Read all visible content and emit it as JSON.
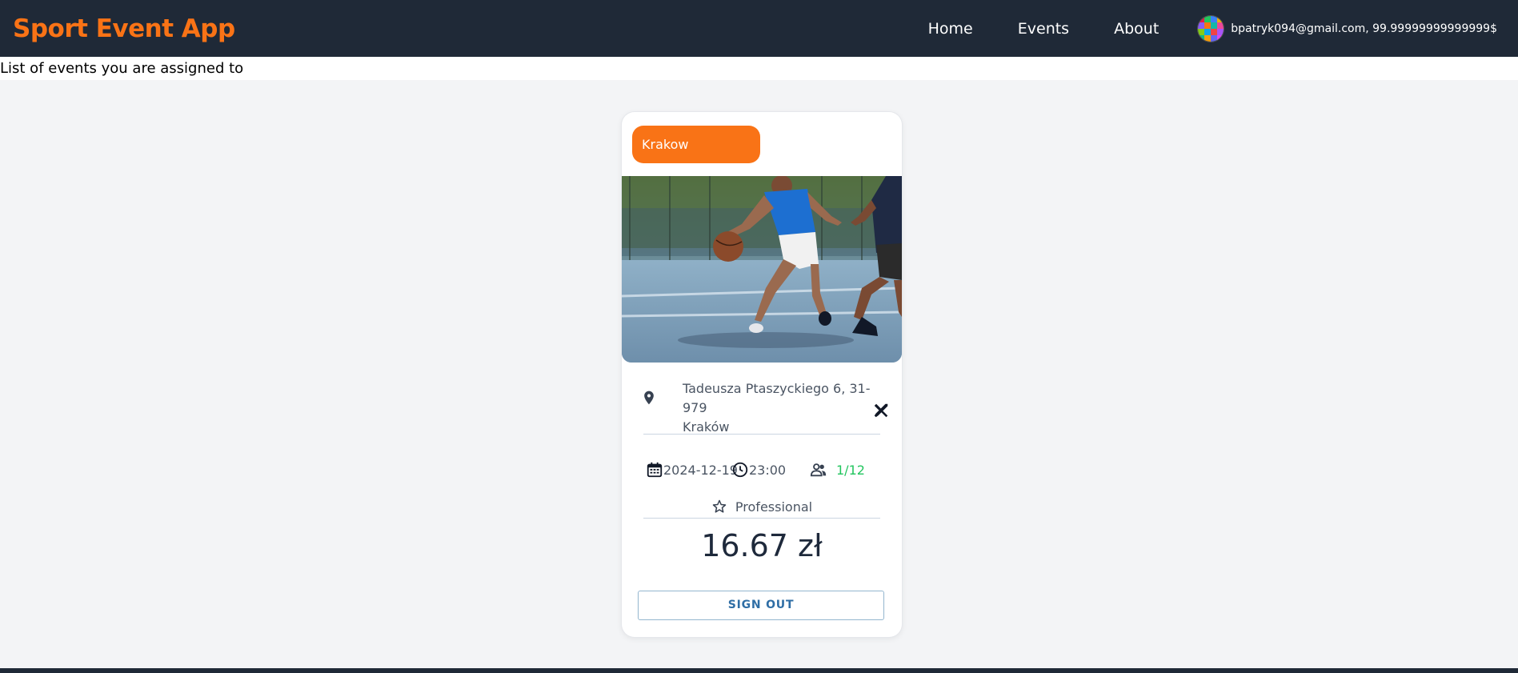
{
  "header": {
    "brand": "Sport Event App",
    "nav": [
      "Home",
      "Events",
      "About"
    ],
    "user": "bpatryk094@gmail.com, 99.99999999999999$"
  },
  "subheader": {
    "text": "List of events you are assigned to"
  },
  "event_card": {
    "city": "Krakow",
    "address_line1": "Tadeusza Ptaszyckiego 6, 31-979",
    "address_line2": "Kraków",
    "date": "2024-12-19",
    "time": "23:00",
    "players": "1/12",
    "level": "Professional",
    "price": "16.67 zł",
    "sign_out_label": "SIGN OUT",
    "image_icon": "basketball-photo",
    "sport_icon": "tools-icon"
  },
  "colors": {
    "brand": "#f97316",
    "nav_bg": "#1f2937",
    "players": "#22c55e",
    "button_text": "#2f6ea5"
  }
}
